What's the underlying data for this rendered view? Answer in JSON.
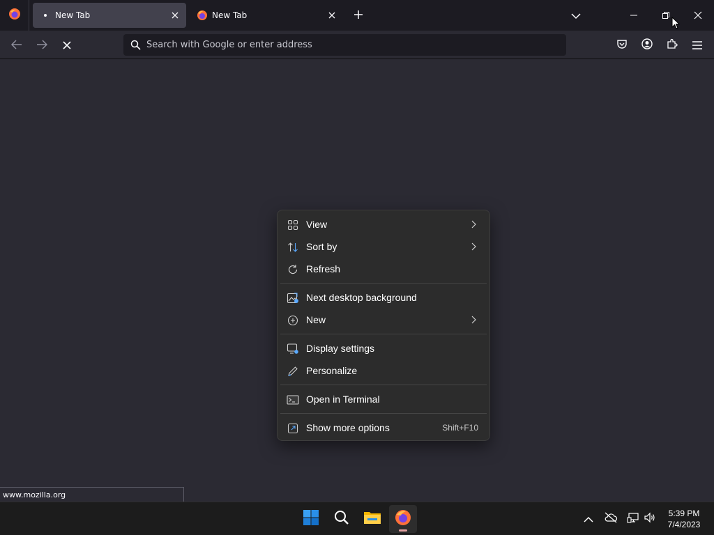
{
  "browser": {
    "tabs": [
      {
        "title": "New Tab",
        "active": true
      },
      {
        "title": "New Tab",
        "active": false
      }
    ],
    "urlbar": {
      "placeholder": "Search with Google or enter address",
      "value": ""
    },
    "status_url": "www.mozilla.org"
  },
  "context_menu": {
    "items": [
      {
        "label": "View",
        "icon": "grid-icon",
        "submenu": true
      },
      {
        "label": "Sort by",
        "icon": "sort-icon",
        "submenu": true
      },
      {
        "label": "Refresh",
        "icon": "refresh-icon",
        "submenu": false
      },
      {
        "label": "Next desktop background",
        "icon": "next-background-icon",
        "submenu": false
      },
      {
        "label": "New",
        "icon": "plus-circle-icon",
        "submenu": true
      },
      {
        "label": "Display settings",
        "icon": "display-settings-icon",
        "submenu": false
      },
      {
        "label": "Personalize",
        "icon": "pen-icon",
        "submenu": false
      },
      {
        "label": "Open in Terminal",
        "icon": "terminal-icon",
        "submenu": false
      },
      {
        "label": "Show more options",
        "icon": "more-options-icon",
        "submenu": false,
        "shortcut": "Shift+F10"
      }
    ]
  },
  "taskbar": {
    "clock": {
      "time": "5:39 PM",
      "date": "7/4/2023"
    }
  },
  "colors": {
    "accent_blue": "#1e90ff",
    "firefox_orange": "#ff7139"
  }
}
